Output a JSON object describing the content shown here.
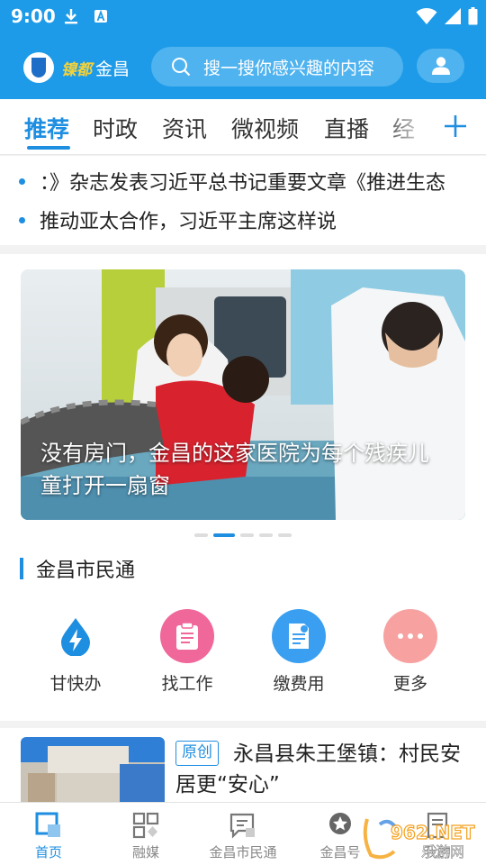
{
  "status_bar": {
    "time": "9:00"
  },
  "header": {
    "logo_calligraphy": "镍都",
    "logo_text": "金昌",
    "search_placeholder": "搜一搜你感兴趣的内容"
  },
  "tabs": [
    {
      "label": "推荐",
      "active": true
    },
    {
      "label": "时政"
    },
    {
      "label": "资讯"
    },
    {
      "label": "微视频"
    },
    {
      "label": "直播"
    },
    {
      "label": "经"
    }
  ],
  "headlines": [
    "：》杂志发表习近平总书记重要文章《推进生态",
    "推动亚太合作，习近平主席这样说"
  ],
  "banner": {
    "title": "没有房门，金昌的这家医院为每个残疾儿童打开一扇窗",
    "pagination": {
      "count": 5,
      "active_index": 1
    }
  },
  "section": {
    "title": "金昌市民通"
  },
  "services": [
    {
      "label": "甘快办",
      "icon": "lightning-drop-icon",
      "color": "#1e8ee0"
    },
    {
      "label": "找工作",
      "icon": "clipboard-icon",
      "color": "#f0679a"
    },
    {
      "label": "缴费用",
      "icon": "bill-icon",
      "color": "#3a9ff0"
    },
    {
      "label": "更多",
      "icon": "more-dots-icon",
      "color": "#f7a1a1"
    }
  ],
  "news": {
    "badge": "原创",
    "title": "永昌县朱王堡镇：村民安居更“安心”"
  },
  "bottom_nav": [
    {
      "label": "首页",
      "icon": "home-icon",
      "active": true
    },
    {
      "label": "融媒",
      "icon": "grid-icon"
    },
    {
      "label": "金昌市民通",
      "icon": "message-icon"
    },
    {
      "label": "金昌号",
      "icon": "star-badge-icon"
    },
    {
      "label": "我的",
      "icon": "document-icon"
    }
  ],
  "watermark": {
    "text_top": "962.NET",
    "text_bottom": "乐游网"
  },
  "colors": {
    "brand_blue": "#1e9be8",
    "accent": "#1e8ee0"
  }
}
